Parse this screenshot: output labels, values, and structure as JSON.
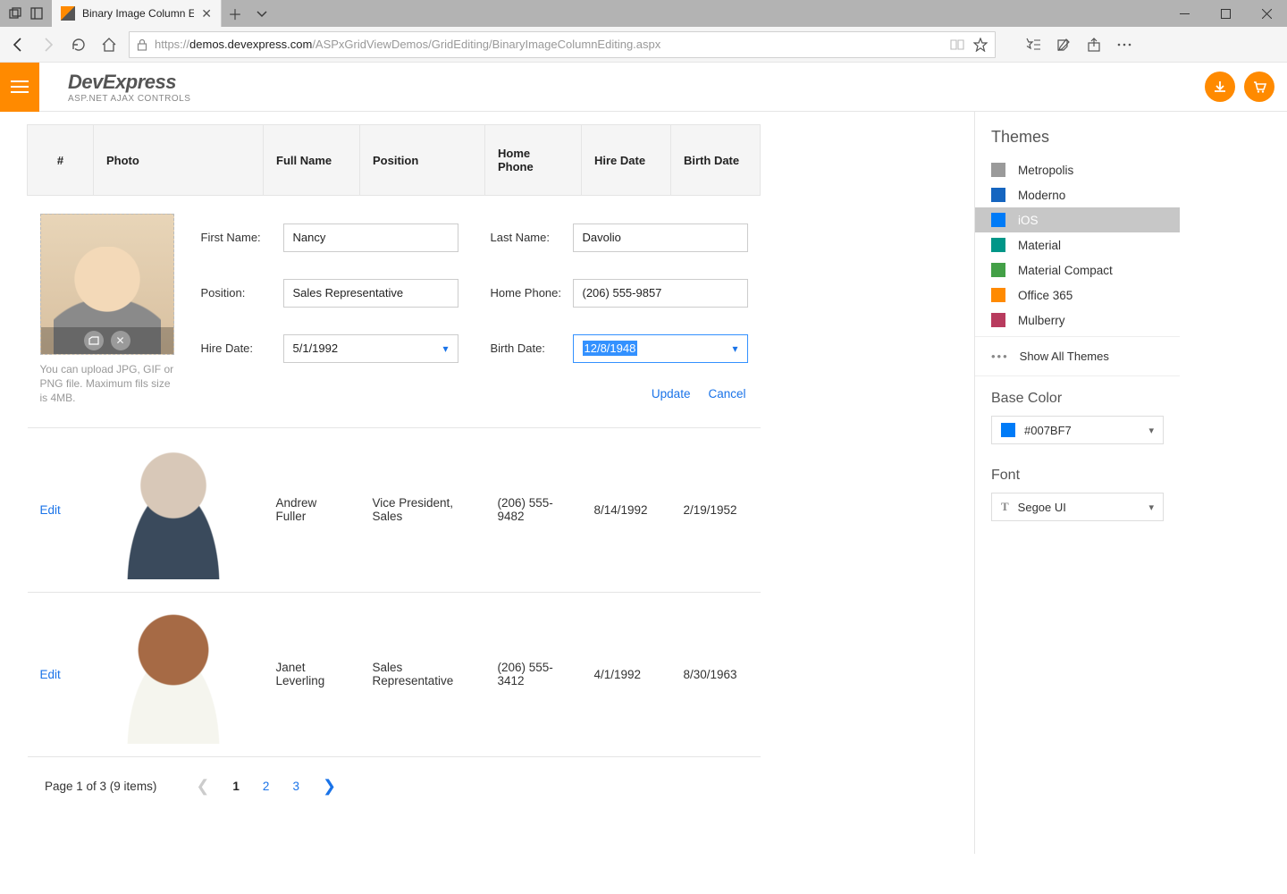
{
  "browser": {
    "tab_title": "Binary Image Column E",
    "url_host": "demos.devexpress.com",
    "url_path": "/ASPxGridViewDemos/GridEditing/BinaryImageColumnEditing.aspx",
    "url_prefix": "https://"
  },
  "header": {
    "brand": "DevExpress",
    "subtitle": "ASP.NET AJAX CONTROLS"
  },
  "grid": {
    "columns": {
      "idx": "#",
      "photo": "Photo",
      "name": "Full Name",
      "position": "Position",
      "phone": "Home Phone",
      "hire": "Hire Date",
      "birth": "Birth Date"
    },
    "edit": {
      "labels": {
        "first": "First Name:",
        "last": "Last Name:",
        "position": "Position:",
        "phone": "Home Phone:",
        "hire": "Hire Date:",
        "birth": "Birth Date:"
      },
      "values": {
        "first": "Nancy",
        "last": "Davolio",
        "position": "Sales Representative",
        "phone": "(206) 555-9857",
        "hire": "5/1/1992",
        "birth": "12/8/1948"
      },
      "hint": "You can upload JPG, GIF or PNG file. Maximum fils size is 4MB.",
      "update": "Update",
      "cancel": "Cancel"
    },
    "rows": [
      {
        "edit": "Edit",
        "name": "Andrew Fuller",
        "position": "Vice President, Sales",
        "phone": "(206) 555-9482",
        "hire": "8/14/1992",
        "birth": "2/19/1952"
      },
      {
        "edit": "Edit",
        "name": "Janet Leverling",
        "position": "Sales Representative",
        "phone": "(206) 555-3412",
        "hire": "4/1/1992",
        "birth": "8/30/1963"
      }
    ]
  },
  "pager": {
    "text": "Page 1 of 3 (9 items)",
    "pages": [
      "1",
      "2",
      "3"
    ]
  },
  "sidebar": {
    "themes_title": "Themes",
    "themes": [
      {
        "name": "Metropolis",
        "color": "#9a9a9a"
      },
      {
        "name": "Moderno",
        "color": "#1565c0"
      },
      {
        "name": "iOS",
        "color": "#007BF7",
        "active": true
      },
      {
        "name": "Material",
        "color": "#009688"
      },
      {
        "name": "Material Compact",
        "color": "#43a047"
      },
      {
        "name": "Office 365",
        "color": "#ff8a00"
      },
      {
        "name": "Mulberry",
        "color": "#b83b5e"
      }
    ],
    "show_all": "Show All Themes",
    "base_color_title": "Base Color",
    "base_color_value": "#007BF7",
    "font_title": "Font",
    "font_value": "Segoe UI"
  }
}
